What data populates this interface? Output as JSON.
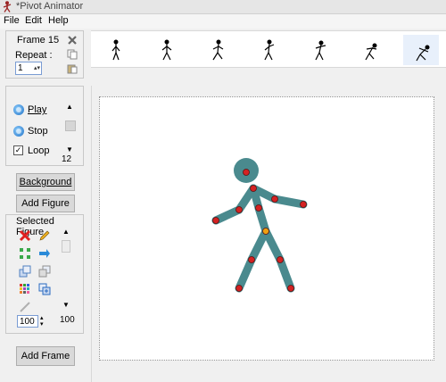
{
  "window": {
    "title": "*Pivot Animator"
  },
  "menu": [
    "File",
    "Edit",
    "Help"
  ],
  "frame_info": {
    "frame_label": "Frame 15",
    "repeat_label": "Repeat :",
    "repeat_value": "1"
  },
  "filmstrip": {
    "frame_count": 7
  },
  "playback": {
    "play_label": "Play",
    "stop_label": "Stop",
    "loop_label": "Loop",
    "loop_checked": true,
    "speed_value": "12"
  },
  "buttons": {
    "background": "Background",
    "add_figure": "Add Figure",
    "add_frame": "Add Frame"
  },
  "selected_figure": {
    "title": "Selected Figure",
    "scale_value": "100",
    "scale_readout": "100"
  },
  "figure": {
    "color": "#4a8a8e",
    "joint_color": "#d42222",
    "pivot_color": "#f0a010"
  }
}
